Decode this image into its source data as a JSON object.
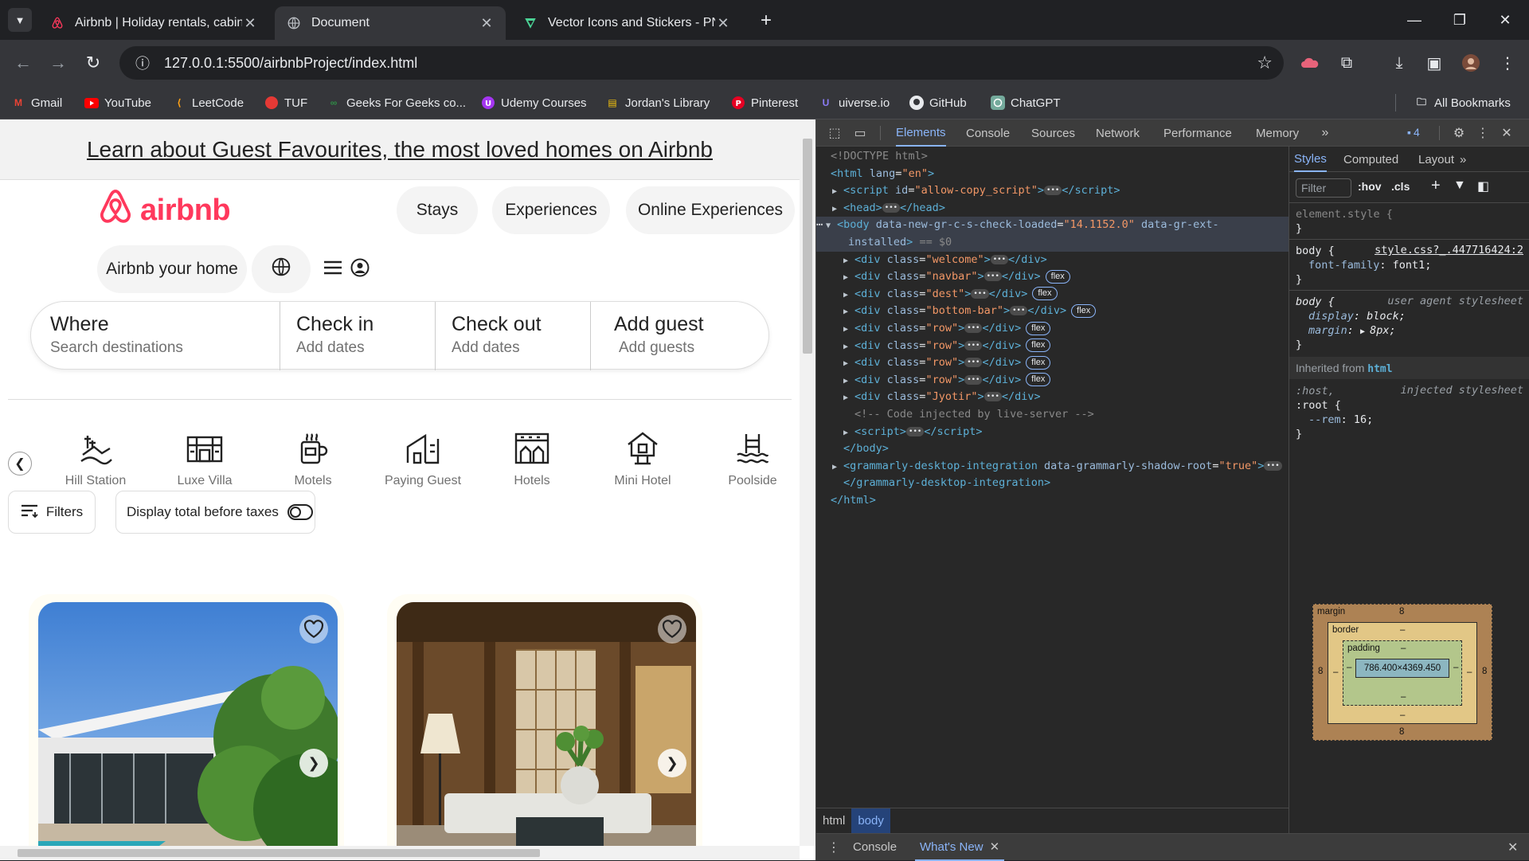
{
  "browser": {
    "tabs": [
      {
        "title": "Airbnb | Holiday rentals, cabins,",
        "icon": "airbnb-icon",
        "active": false
      },
      {
        "title": "Document",
        "icon": "globe-icon",
        "active": true
      },
      {
        "title": "Vector Icons and Stickers - PNG",
        "icon": "flaticon-icon",
        "active": false
      }
    ],
    "new_tab": "+",
    "url": "127.0.0.1:5500/airbnbProject/index.html",
    "bookmarks": [
      {
        "label": "Gmail",
        "icon": "gmail-icon"
      },
      {
        "label": "YouTube",
        "icon": "youtube-icon"
      },
      {
        "label": "LeetCode",
        "icon": "leetcode-icon"
      },
      {
        "label": "TUF",
        "icon": "tuf-icon"
      },
      {
        "label": "Geeks For Geeks co...",
        "icon": "gfg-icon"
      },
      {
        "label": "Udemy Courses",
        "icon": "udemy-icon"
      },
      {
        "label": "Jordan's Library",
        "icon": "folder-books-icon"
      },
      {
        "label": "Pinterest",
        "icon": "pinterest-icon"
      },
      {
        "label": "uiverse.io",
        "icon": "uiverse-icon"
      },
      {
        "label": "GitHub",
        "icon": "github-icon"
      },
      {
        "label": "ChatGPT",
        "icon": "chatgpt-icon"
      }
    ],
    "all_bookmarks": "All Bookmarks"
  },
  "page": {
    "welcome": "Learn about Guest Favourites, the most loved homes on Airbnb",
    "logo_text": "airbnb",
    "nav": {
      "stays": "Stays",
      "experiences": "Experiences",
      "online": "Online Experiences"
    },
    "host": "Airbnb your home",
    "search": {
      "where": {
        "title": "Where",
        "sub": "Search destinations"
      },
      "checkin": {
        "title": "Check in",
        "sub": "Add dates"
      },
      "checkout": {
        "title": "Check out",
        "sub": "Add dates"
      },
      "guest": {
        "title": "Add guest",
        "sub": "Add guests"
      }
    },
    "categories": [
      {
        "label": "Hill Station",
        "icon": "hill-station-icon"
      },
      {
        "label": "Luxe Villa",
        "icon": "villa-icon"
      },
      {
        "label": "Motels",
        "icon": "motel-icon"
      },
      {
        "label": "Paying Guest",
        "icon": "paying-guest-icon"
      },
      {
        "label": "Hotels",
        "icon": "hotel-icon"
      },
      {
        "label": "Mini Hotel",
        "icon": "mini-hotel-icon"
      },
      {
        "label": "Poolside",
        "icon": "pool-icon"
      }
    ],
    "filters": "Filters",
    "taxes": "Display total before taxes",
    "brand_color": "#ff385c"
  },
  "devtools": {
    "tabs": [
      "Elements",
      "Console",
      "Sources",
      "Network",
      "Performance",
      "Memory"
    ],
    "issues_count": "4",
    "dom": {
      "doctype": "<!DOCTYPE html>",
      "html_open": "<html",
      "lang_attr": "lang",
      "lang_val": "\"en\"",
      "script_id": "\"allow-copy_script\"",
      "body_attr1_val": "\"14.1152.0\"",
      "body_dollar": "== $0",
      "div_classes": [
        "\"welcome\"",
        "\"navbar\"",
        "\"dest\"",
        "\"bottom-bar\"",
        "\"row\"",
        "\"row\"",
        "\"row\"",
        "\"row\"",
        "\"Jyotir\""
      ],
      "flex_label": "flex",
      "comment": "<!-- Code injected by live-server -->",
      "grammarly_val": "\"true\""
    },
    "breadcrumbs": [
      "html",
      "body"
    ],
    "styles_tabs": [
      "Styles",
      "Computed",
      "Layout"
    ],
    "filter_placeholder": "Filter",
    "hov": ":hov",
    "cls": ".cls",
    "element_style": "element.style {",
    "body_source": "style.css?_.447716424:2",
    "font_family_value": "font1;",
    "ua_label": "user agent stylesheet",
    "display_value": "block;",
    "margin_value": "8px;",
    "inherited_from": "Inherited from",
    "inherited_tag": "html",
    "host_selector": ":host,",
    "injected_label": "injected stylesheet",
    "root_selector": ":root {",
    "rem_prop": "--rem",
    "rem_value": "16;",
    "box": {
      "margin_label": "margin",
      "margin_top": "8",
      "margin_bottom": "8",
      "margin_left": "8",
      "margin_right": "8",
      "border_label": "border",
      "border_val": "–",
      "padding_label": "padding",
      "padding_val": "–",
      "content": "786.400×4369.450"
    },
    "drawer": {
      "console": "Console",
      "whats_new": "What's New"
    }
  }
}
